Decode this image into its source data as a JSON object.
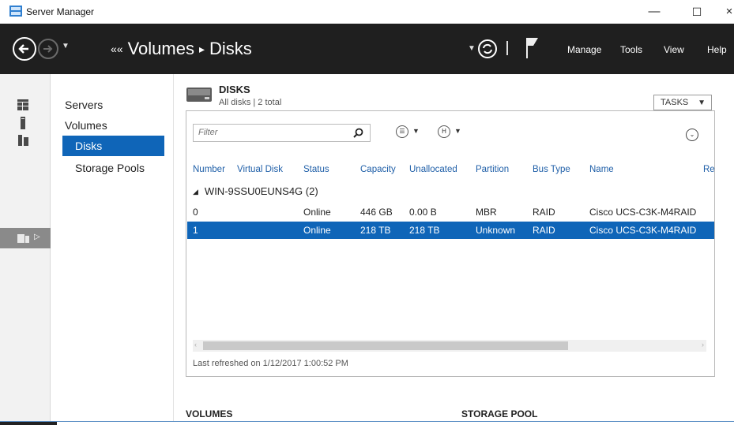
{
  "window": {
    "title": "Server Manager",
    "min_glyph": "—",
    "max_glyph": "☐",
    "close_glyph": "×"
  },
  "header": {
    "lead_glyph": "««",
    "crumb1": "Volumes",
    "crumb_sep": "▸",
    "crumb2": "Disks",
    "menus": {
      "manage": "Manage",
      "tools": "Tools",
      "view": "View",
      "help": "Help"
    }
  },
  "nav": {
    "items": [
      {
        "label": "Servers"
      },
      {
        "label": "Volumes"
      },
      {
        "label": "Disks"
      },
      {
        "label": "Storage Pools"
      }
    ],
    "active": "Disks"
  },
  "tile": {
    "title": "DISKS",
    "subtitle": "All disks | 2 total",
    "tasks_label": "TASKS",
    "filter_placeholder": "Filter"
  },
  "table": {
    "columns": [
      "Number",
      "Virtual Disk",
      "Status",
      "Capacity",
      "Unallocated",
      "Partition",
      "Bus Type",
      "Name",
      "Re"
    ],
    "group": "WIN-9SSU0EUNS4G (2)",
    "rows": [
      {
        "number": "0",
        "virtual_disk": "",
        "status": "Online",
        "capacity": "446 GB",
        "unallocated": "0.00 B",
        "partition": "MBR",
        "bus_type": "RAID",
        "name": "Cisco UCS-C3K-M4RAID",
        "selected": false
      },
      {
        "number": "1",
        "virtual_disk": "",
        "status": "Online",
        "capacity": "218 TB",
        "unallocated": "218 TB",
        "partition": "Unknown",
        "bus_type": "RAID",
        "name": "Cisco UCS-C3K-M4RAID",
        "selected": true
      }
    ],
    "refreshed": "Last refreshed on 1/12/2017 1:00:52 PM"
  },
  "sections": {
    "volumes": "VOLUMES",
    "storage_pool": "STORAGE POOL"
  },
  "colors": {
    "header_bg": "#1f1f1f",
    "accent": "#0f65b8",
    "column_text": "#1f5fa8"
  }
}
